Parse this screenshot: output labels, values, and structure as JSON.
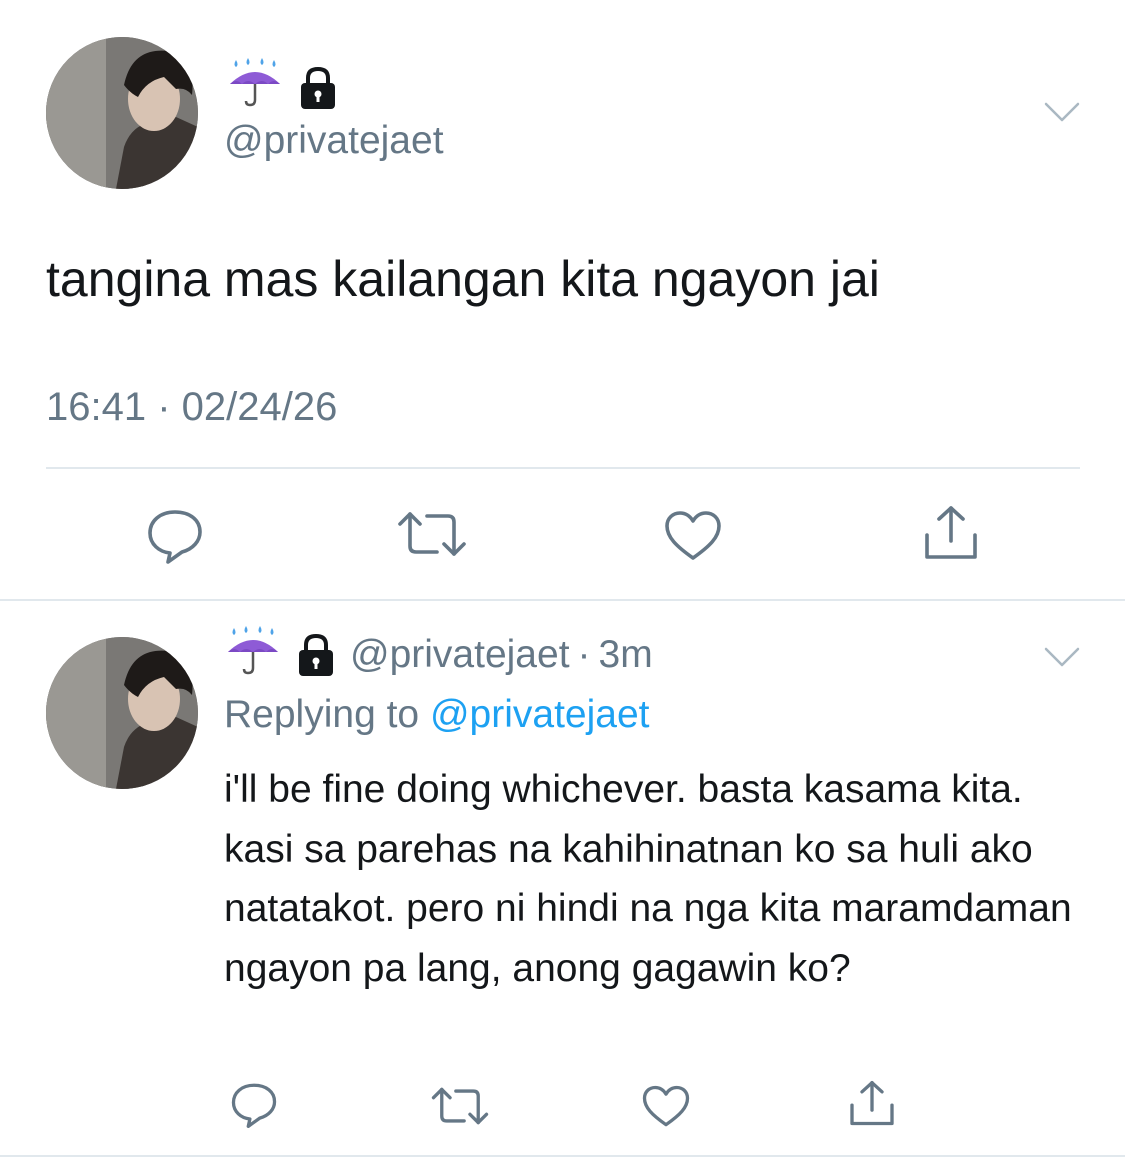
{
  "main_tweet": {
    "display_name_emoji": "☔",
    "handle": "@privatejaet",
    "text": "tangina mas kailangan kita ngayon jai",
    "timestamp": "16:41 · 02/24/26"
  },
  "reply_tweet": {
    "display_name_emoji": "☔",
    "handle": "@privatejaet",
    "separator": "·",
    "time_ago": "3m",
    "replying_label": "Replying to",
    "replying_handle": "@privatejaet",
    "text": "i'll be fine doing whichever. basta kasama kita. kasi sa parehas na kahihinatnan ko sa huli ako natatakot. pero ni hindi na nga kita maramdaman ngayon pa lang, anong gagawin ko?"
  },
  "icons": {
    "reply": "reply-icon",
    "retweet": "retweet-icon",
    "like": "heart-icon",
    "share": "share-icon",
    "more": "chevron-down-icon",
    "protected": "lock-icon",
    "display_name": "umbrella-with-rain-icon"
  },
  "colors": {
    "text_primary": "#14171a",
    "text_secondary": "#657786",
    "link": "#1da1f2",
    "divider": "#e1e8ed",
    "icon": "#657786"
  }
}
